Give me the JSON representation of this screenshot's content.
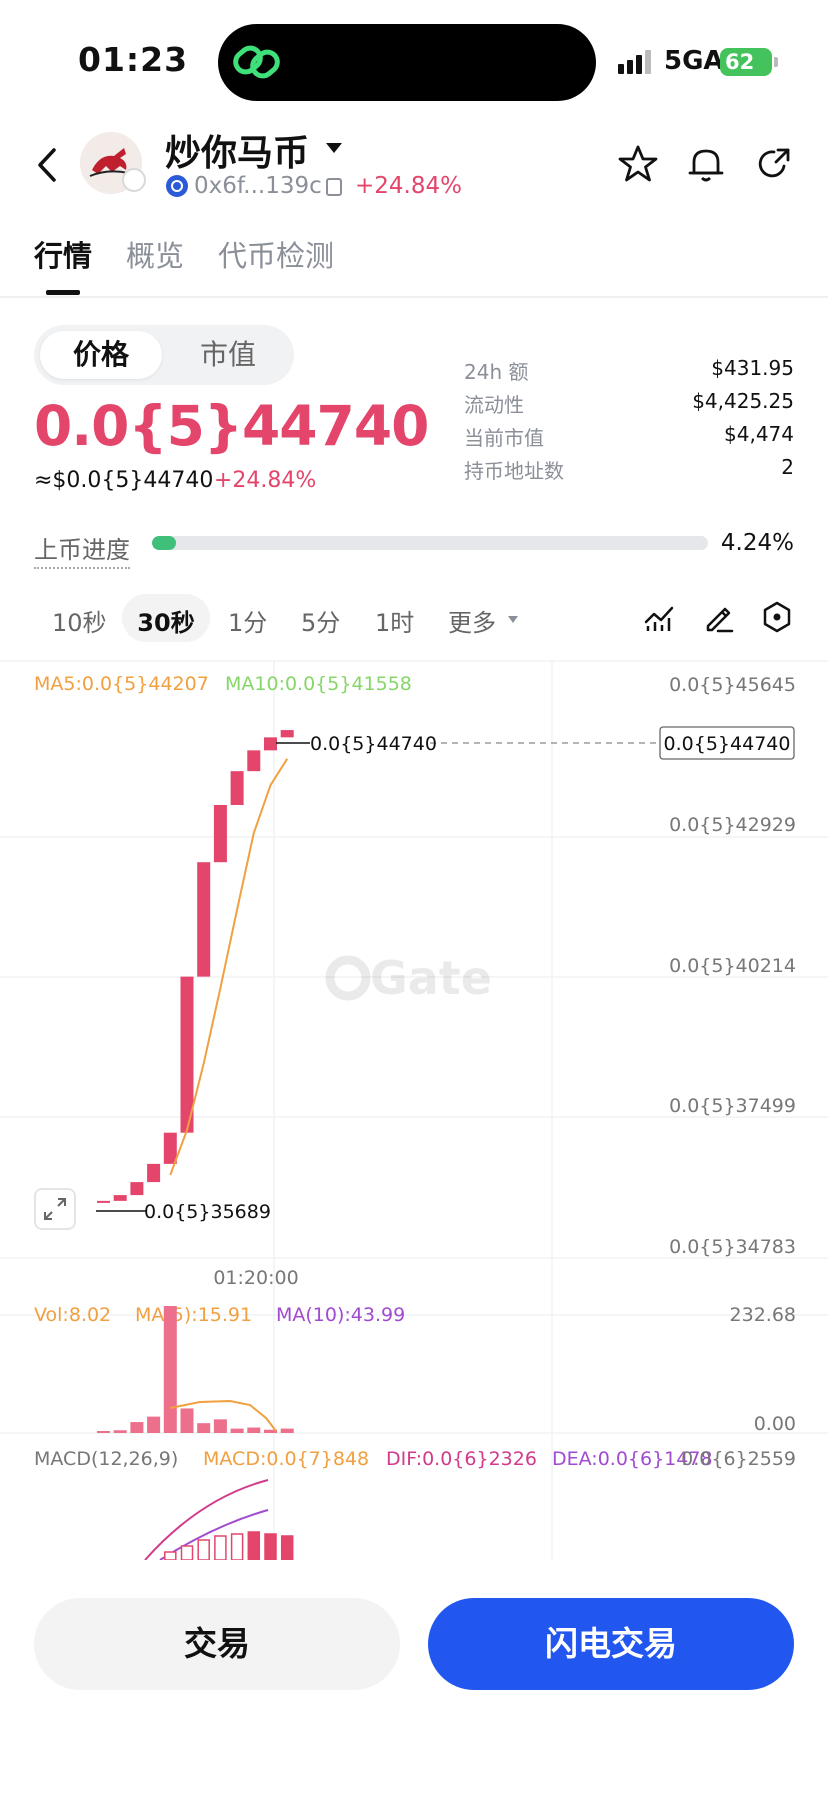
{
  "status_bar": {
    "time": "01:23",
    "network": "5GA",
    "battery": "62"
  },
  "header": {
    "title": "炒你马币",
    "address": "0x6f...139c",
    "change": "+24.84%"
  },
  "tabs": [
    {
      "label": "行情",
      "active": true
    },
    {
      "label": "概览",
      "active": false
    },
    {
      "label": "代币检测",
      "active": false
    }
  ],
  "price_toggle": {
    "price": "价格",
    "market_cap": "市值"
  },
  "price": {
    "main": "0.0{5}44740",
    "usd": "≈$0.0{5}44740",
    "change": "+24.84%"
  },
  "stats": [
    {
      "label": "24h  额",
      "value": "$431.95"
    },
    {
      "label": "流动性",
      "value": "$4,425.25"
    },
    {
      "label": "当前市值",
      "value": "$4,474"
    },
    {
      "label": "持币地址数",
      "value": "2"
    }
  ],
  "listing_progress": {
    "label": "上币进度",
    "percent_text": "4.24%",
    "fraction": 0.0424
  },
  "intervals": [
    "10秒",
    "30秒",
    "1分",
    "5分",
    "1时",
    "更多"
  ],
  "active_interval": "30秒",
  "chart": {
    "ma5_label": "MA5:0.0{5}44207",
    "ma10_label": "MA10:0.0{5}41558",
    "price_axis": [
      "0.0{5}45645",
      "0.0{5}42929",
      "0.0{5}40214",
      "0.0{5}37499",
      "0.0{5}34783"
    ],
    "last_price_tag": "0.0{5}44740",
    "high_label": "0.0{5}44740",
    "low_label": "0.0{5}35689",
    "time_label": "01:20:00",
    "watermark": "Gate",
    "vol_label": "Vol:8.02",
    "vol_ma5_label": "MA(5):15.91",
    "vol_ma10_label": "MA(10):43.99",
    "vol_axis": [
      "232.68",
      "0.00"
    ],
    "macd_label": "MACD(12,26,9)",
    "macd_value": "MACD:0.0{7}848",
    "dif_value": "DIF:0.0{6}2326",
    "dea_value": "DEA:0.0{6}1478",
    "macd_axis_top": "0.0{6}2559",
    "colors": {
      "up": "#e3456b",
      "ma5": "#f0a040",
      "ma10": "#86d66a",
      "vol_ma10": "#a04bd0",
      "dif": "#d03b8a",
      "dea": "#a04bd0"
    }
  },
  "chart_data": {
    "type": "candlestick",
    "candles_close_scaled_1e5": [
      0.35689,
      0.358,
      0.3605,
      0.364,
      0.37,
      0.4,
      0.422,
      0.433,
      0.4395,
      0.4435,
      0.446,
      0.4474
    ],
    "candles_open_scaled_1e5": [
      0.35689,
      0.35689,
      0.358,
      0.3605,
      0.364,
      0.37,
      0.4,
      0.422,
      0.433,
      0.4395,
      0.4435,
      0.446
    ],
    "ylim_scaled_1e5": [
      0.34783,
      0.45645
    ],
    "volume": [
      2,
      5,
      20,
      30,
      232.68,
      45,
      18,
      25,
      8,
      10,
      6,
      8.02
    ]
  },
  "buttons": {
    "trade": "交易",
    "flash_trade": "闪电交易"
  }
}
